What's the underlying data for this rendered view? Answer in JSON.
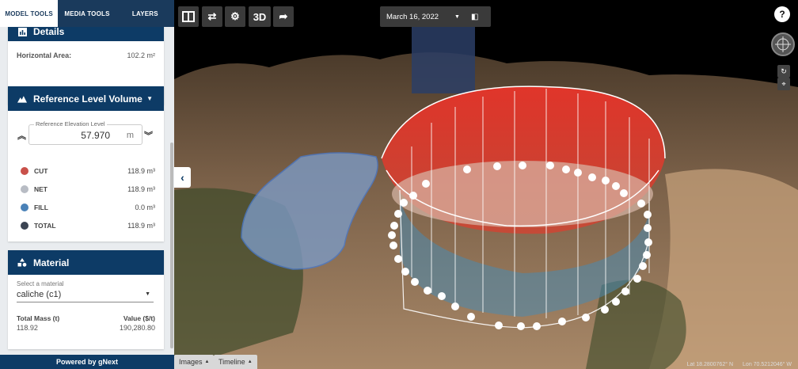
{
  "tabs": {
    "model": "MODEL TOOLS",
    "media": "MEDIA TOOLS",
    "layers": "LAYERS"
  },
  "details": {
    "title": "Details",
    "area_label": "Horizontal Area:",
    "area_value": "102.2 m²"
  },
  "ref_volume": {
    "title": "Reference Level Volume",
    "elev_label": "Reference Elevation Level",
    "elev_value": "57.970",
    "elev_unit": "m",
    "rows": [
      {
        "name": "CUT",
        "value": "118.9 m³",
        "color": "#c9514a"
      },
      {
        "name": "NET",
        "value": "118.9 m³",
        "color": "#b8bcc4"
      },
      {
        "name": "FILL",
        "value": "0.0 m³",
        "color": "#4a82b8"
      },
      {
        "name": "TOTAL",
        "value": "118.9 m³",
        "color": "#3b4452"
      }
    ]
  },
  "material": {
    "title": "Material",
    "select_label": "Select a material",
    "selected": "caliche (c1)",
    "mass_label": "Total Mass (t)",
    "mass_value": "118.92",
    "value_label": "Value ($/t)",
    "value_value": "190,280.80"
  },
  "powered": "Powered by gNext",
  "toolbar": {
    "three_d": "3D",
    "date": "March 16, 2022"
  },
  "help": "?",
  "bottom": {
    "images": "Images",
    "timeline": "Timeline"
  },
  "coords": {
    "lat": "Lat 18.2800762° N",
    "lon": "Lon 70.5212046° W"
  },
  "colors": {
    "brand": "#0d3b66",
    "cut": "#e0392d",
    "fill": "#4a82b8"
  }
}
